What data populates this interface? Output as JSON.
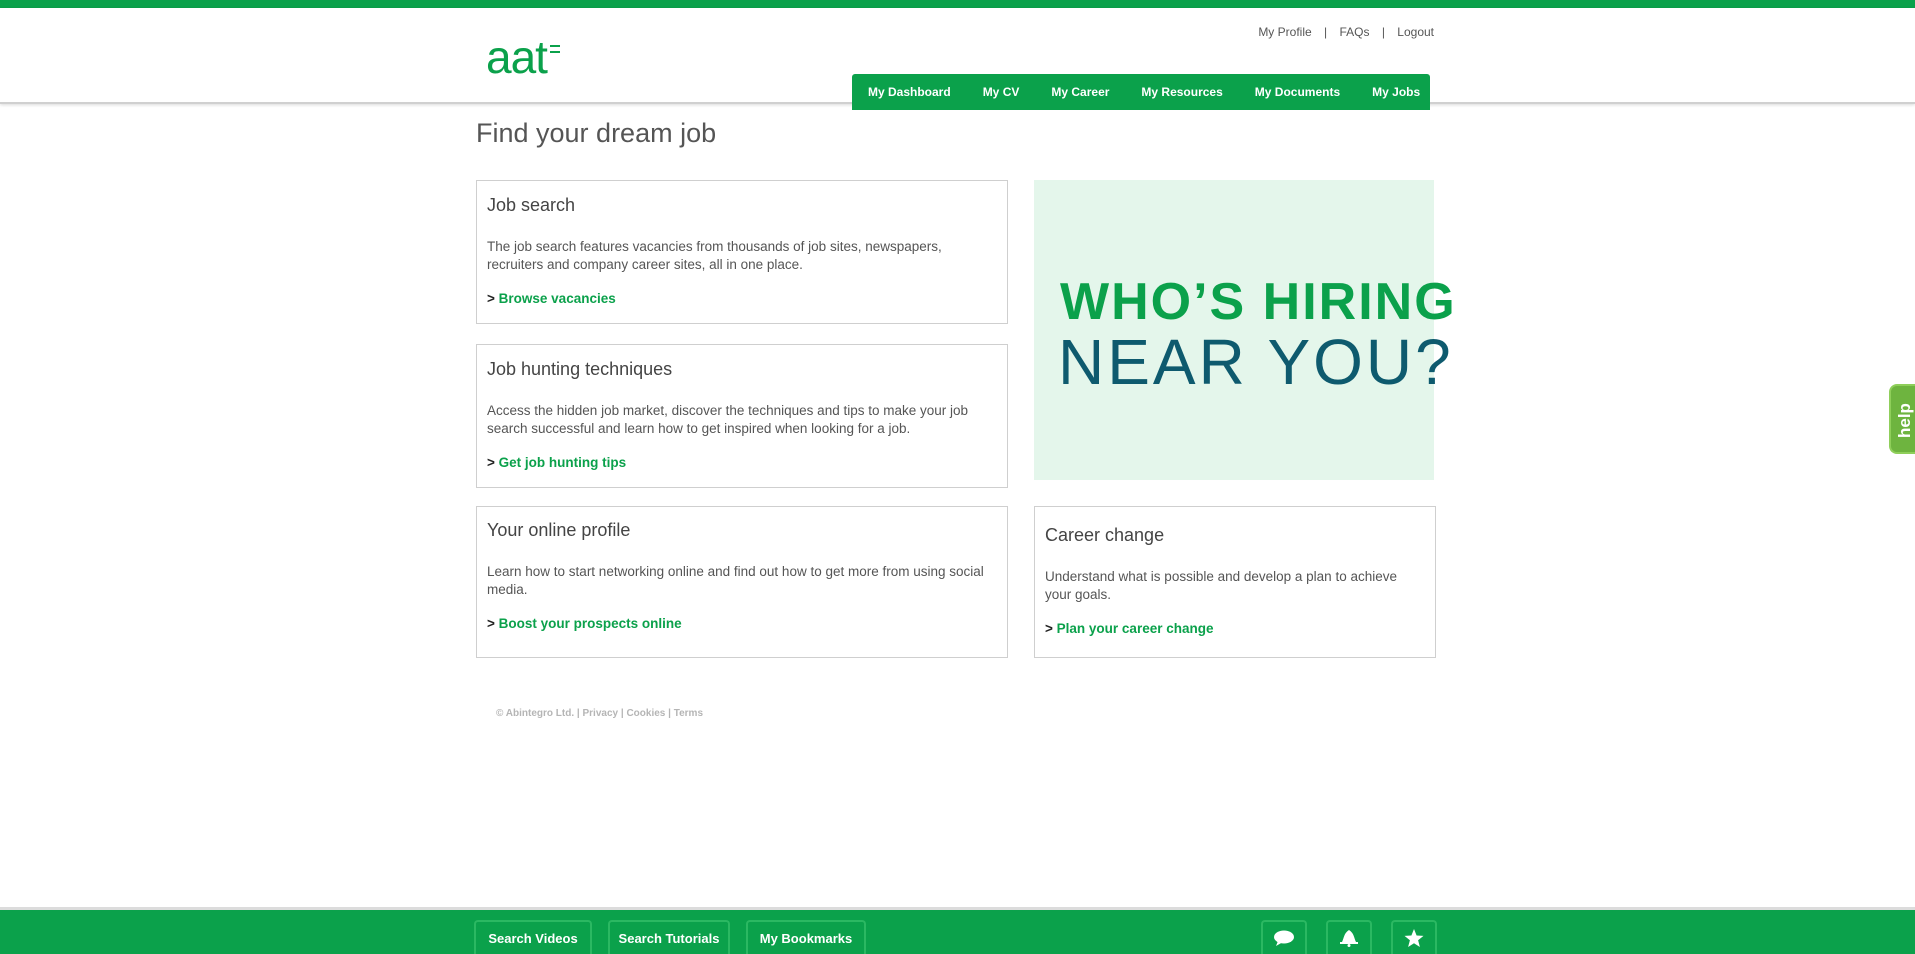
{
  "header": {
    "logo_text": "aat",
    "top_links": [
      "My Profile",
      "FAQs",
      "Logout"
    ],
    "top_link_separator": "|",
    "nav": [
      "My Dashboard",
      "My CV",
      "My Career",
      "My Resources",
      "My Documents",
      "My Jobs"
    ]
  },
  "page": {
    "title": "Find your dream job"
  },
  "cards": {
    "job_search": {
      "title": "Job search",
      "text": "The job search features vacancies from thousands of job sites, newspapers, recruiters and company career sites, all in one place.",
      "arrow": ">",
      "link": "Browse vacancies"
    },
    "job_hunting": {
      "title": "Job hunting techniques",
      "text": "Access the hidden job market, discover the techniques and tips to make your job search successful and learn how to get inspired when looking for a job.",
      "arrow": ">",
      "link": "Get job hunting tips"
    },
    "online_profile": {
      "title": "Your online profile",
      "text": "Learn how to start networking online and find out how to get more from using social media.",
      "arrow": ">",
      "link": "Boost your prospects online"
    },
    "career_change": {
      "title": "Career change",
      "text": "Understand what is possible and develop a plan to achieve your goals.",
      "arrow": ">",
      "link": "Plan your career change"
    }
  },
  "banner": {
    "line1": "WHO’S HIRING",
    "line2": "NEAR YOU?"
  },
  "footer": {
    "copyright": "© Abintegro Ltd.",
    "links": [
      "Privacy",
      "Cookies",
      "Terms"
    ],
    "sep": "|"
  },
  "help_tab": {
    "label": "help"
  },
  "bottom_bar": {
    "tabs": [
      "Search Videos",
      "Search Tutorials",
      "My Bookmarks"
    ],
    "icons": [
      "chat-bubble-icon",
      "bell-icon",
      "star-icon"
    ]
  },
  "colors": {
    "brand_green": "#0ba14b",
    "banner_bg": "#e4f6eb",
    "banner_dark": "#0e5a6e",
    "help_green": "#6eb43f"
  }
}
